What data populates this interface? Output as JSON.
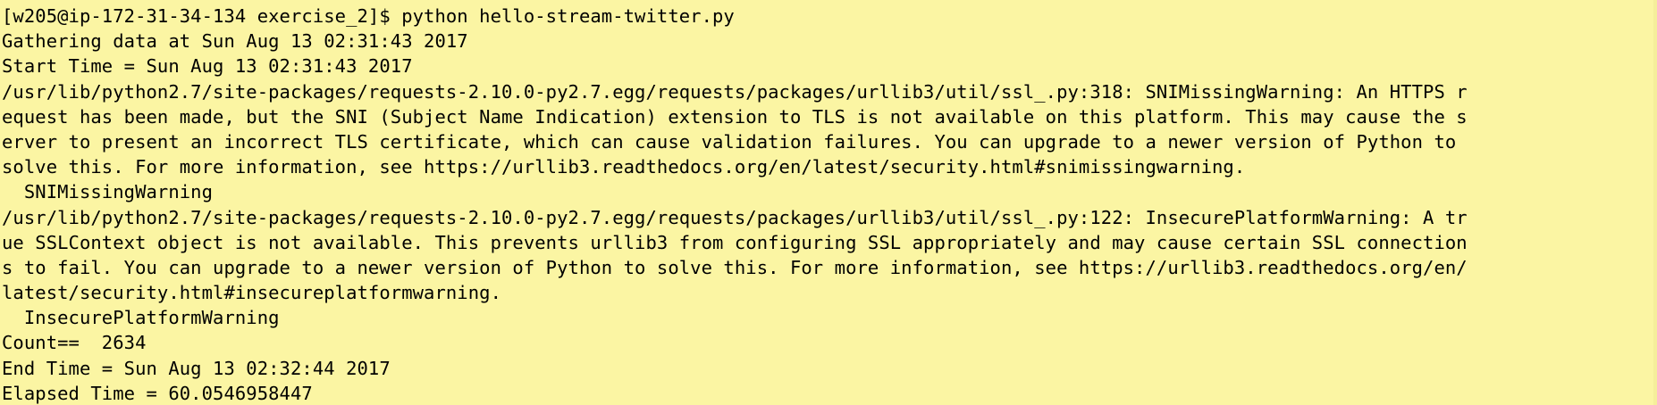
{
  "terminal": {
    "background": "#fbf5a3",
    "foreground": "#000000",
    "lines": [
      "[w205@ip-172-31-34-134 exercise_2]$ python hello-stream-twitter.py",
      "Gathering data at Sun Aug 13 02:31:43 2017",
      "Start Time = Sun Aug 13 02:31:43 2017",
      "/usr/lib/python2.7/site-packages/requests-2.10.0-py2.7.egg/requests/packages/urllib3/util/ssl_.py:318: SNIMissingWarning: An HTTPS r",
      "equest has been made, but the SNI (Subject Name Indication) extension to TLS is not available on this platform. This may cause the s",
      "erver to present an incorrect TLS certificate, which can cause validation failures. You can upgrade to a newer version of Python to ",
      "solve this. For more information, see https://urllib3.readthedocs.org/en/latest/security.html#snimissingwarning.",
      "  SNIMissingWarning",
      "/usr/lib/python2.7/site-packages/requests-2.10.0-py2.7.egg/requests/packages/urllib3/util/ssl_.py:122: InsecurePlatformWarning: A tr",
      "ue SSLContext object is not available. This prevents urllib3 from configuring SSL appropriately and may cause certain SSL connection",
      "s to fail. You can upgrade to a newer version of Python to solve this. For more information, see https://urllib3.readthedocs.org/en/",
      "latest/security.html#insecureplatformwarning.",
      "  InsecurePlatformWarning",
      "Count==  2634",
      "End Time = Sun Aug 13 02:32:44 2017",
      "Elapsed Time = 60.0546958447"
    ]
  }
}
